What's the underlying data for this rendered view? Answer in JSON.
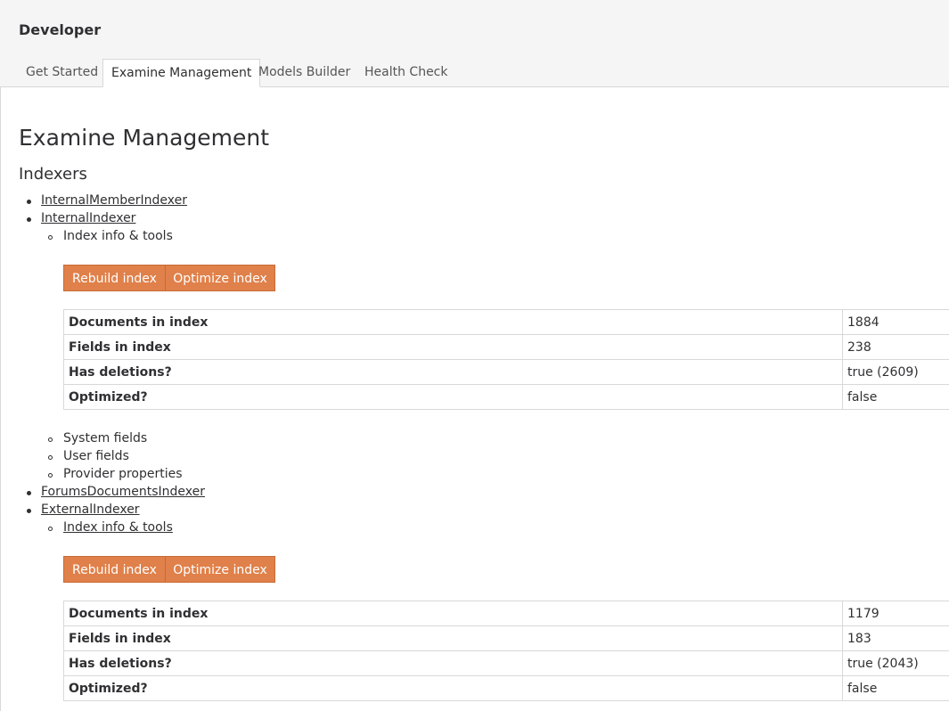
{
  "header": {
    "section_title": "Developer",
    "tabs": [
      {
        "label": "Get Started",
        "active": false
      },
      {
        "label": "Examine Management",
        "active": true
      },
      {
        "label": "Models Builder",
        "active": false
      },
      {
        "label": "Health Check",
        "active": false
      }
    ]
  },
  "main": {
    "title": "Examine Management",
    "subtitle": "Indexers",
    "indexers": [
      {
        "name": "InternalMemberIndexer"
      },
      {
        "name": "InternalIndexer",
        "info_label": "Index info & tools",
        "buttons": {
          "rebuild": "Rebuild index",
          "optimize": "Optimize index"
        },
        "stats": [
          {
            "key": "Documents in index",
            "value": "1884"
          },
          {
            "key": "Fields in index",
            "value": "238"
          },
          {
            "key": "Has deletions?",
            "value": "true (2609)"
          },
          {
            "key": "Optimized?",
            "value": "false"
          }
        ],
        "sections": [
          "System fields",
          "User fields",
          "Provider properties"
        ]
      },
      {
        "name": "ForumsDocumentsIndexer"
      },
      {
        "name": "ExternalIndexer",
        "info_label": "Index info & tools",
        "buttons": {
          "rebuild": "Rebuild index",
          "optimize": "Optimize index"
        },
        "stats": [
          {
            "key": "Documents in index",
            "value": "1179"
          },
          {
            "key": "Fields in index",
            "value": "183"
          },
          {
            "key": "Has deletions?",
            "value": "true (2043)"
          },
          {
            "key": "Optimized?",
            "value": "false"
          }
        ]
      }
    ]
  },
  "colors": {
    "button_bg": "#e0804a",
    "text": "#303033",
    "border": "#d8d8d8"
  }
}
